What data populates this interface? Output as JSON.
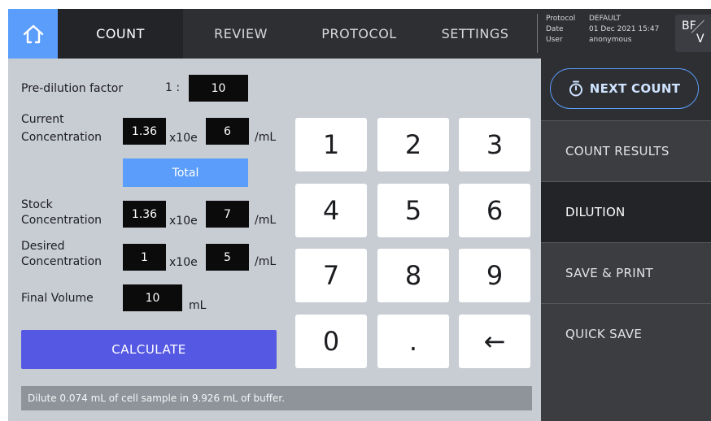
{
  "topbar": {
    "tabs": [
      {
        "label": "COUNT",
        "active": true
      },
      {
        "label": "REVIEW",
        "active": false
      },
      {
        "label": "PROTOCOL",
        "active": false
      },
      {
        "label": "SETTINGS",
        "active": false
      }
    ],
    "info": {
      "protocol_label": "Protocol",
      "protocol_value": "DEFAULT",
      "date_label": "Date",
      "date_value": "01 Dec 2021 15:47",
      "user_label": "User",
      "user_value": "anonymous"
    },
    "mode_badge": {
      "top": "BF",
      "bottom": "V"
    }
  },
  "form": {
    "predilution": {
      "label": "Pre-dilution factor",
      "ratio_prefix": "1 :",
      "value": "10"
    },
    "current": {
      "label_line1": "Current",
      "label_line2": "Concentration",
      "mantissa": "1.36",
      "exp_label": "x10e",
      "exponent": "6",
      "unit": "/mL"
    },
    "total_button": "Total",
    "stock": {
      "label_line1": "Stock",
      "label_line2": "Concentration",
      "mantissa": "1.36",
      "exp_label": "x10e",
      "exponent": "7",
      "unit": "/mL"
    },
    "desired": {
      "label_line1": "Desired",
      "label_line2": "Concentration",
      "mantissa": "1",
      "exp_label": "x10e",
      "exponent": "5",
      "unit": "/mL"
    },
    "final_volume": {
      "label": "Final Volume",
      "value": "10",
      "unit": "mL"
    },
    "calculate_button": "CALCULATE"
  },
  "keypad": {
    "keys": [
      "1",
      "2",
      "3",
      "4",
      "5",
      "6",
      "7",
      "8",
      "9",
      "0",
      ".",
      "←"
    ]
  },
  "status": {
    "message": "Dilute 0.074 mL of cell sample in 9.926 mL of buffer."
  },
  "sidebar": {
    "next_count": "NEXT COUNT",
    "items": [
      {
        "label": "COUNT RESULTS",
        "active": false
      },
      {
        "label": "DILUTION",
        "active": true
      },
      {
        "label": "SAVE & PRINT",
        "active": false
      },
      {
        "label": "QUICK SAVE",
        "active": false
      }
    ]
  },
  "colors": {
    "accent": "#5b9dfb",
    "calculate": "#5558e3",
    "topbar": "#2d2f33",
    "sidebar": "#3b3d41",
    "content_bg": "#c8ccd3"
  }
}
